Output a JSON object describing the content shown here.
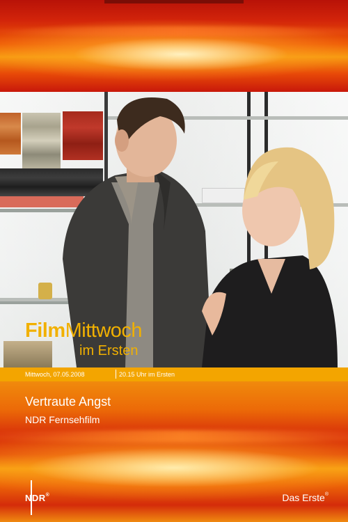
{
  "logo": {
    "film": "Film",
    "mittwoch": "Mittwoch",
    "sub": "im Ersten"
  },
  "date_strip": {
    "date": "Mittwoch, 07.05.2008",
    "time": "20.15 Uhr im Ersten"
  },
  "title": "Vertraute Angst",
  "subtitle": "NDR Fernsehfilm",
  "brands": {
    "ndr": "NDR",
    "ndr_mark": "®",
    "erste": "Das Erste",
    "erste_mark": "®"
  },
  "colors": {
    "accent_orange": "#f3a500",
    "logo_gold": "#f1b000",
    "band_red": "#c8180a"
  }
}
